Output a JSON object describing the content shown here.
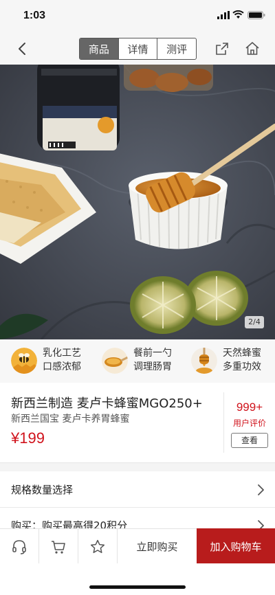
{
  "status_bar": {
    "time": "1:03"
  },
  "nav": {
    "tabs": [
      {
        "label": "商品"
      },
      {
        "label": "详情"
      },
      {
        "label": "测评"
      }
    ],
    "back_icon": "chevron-left-icon",
    "share_icon": "share-icon",
    "home_icon": "home-icon"
  },
  "hero": {
    "page_indicator": "2/4"
  },
  "features": [
    {
      "icon": "bee-icon",
      "line1": "乳化工艺",
      "line2": "口感浓郁"
    },
    {
      "icon": "honey-spoon-icon",
      "line1": "餐前一勺",
      "line2": "调理肠胃"
    },
    {
      "icon": "honey-dipper-icon",
      "line1": "天然蜂蜜",
      "line2": "多重功效"
    }
  ],
  "product": {
    "title": "新西兰制造 麦卢卡蜂蜜MGO250+",
    "subtitle": "新西兰国宝 麦卢卡养胃蜂蜜",
    "price": "¥199",
    "review_count": "999+",
    "review_label": "用户评价",
    "view_button": "查看"
  },
  "spec_row": {
    "label": "规格数量选择"
  },
  "purchase_row": {
    "label": "购买：购买最高得20积分"
  },
  "bottom_bar": {
    "icons": [
      "headset-icon",
      "cart-icon",
      "star-icon"
    ],
    "buy_now": "立即购买",
    "add_to_cart": "加入购物车"
  },
  "colors": {
    "accent": "#b81c1c",
    "price": "#d0121b"
  }
}
